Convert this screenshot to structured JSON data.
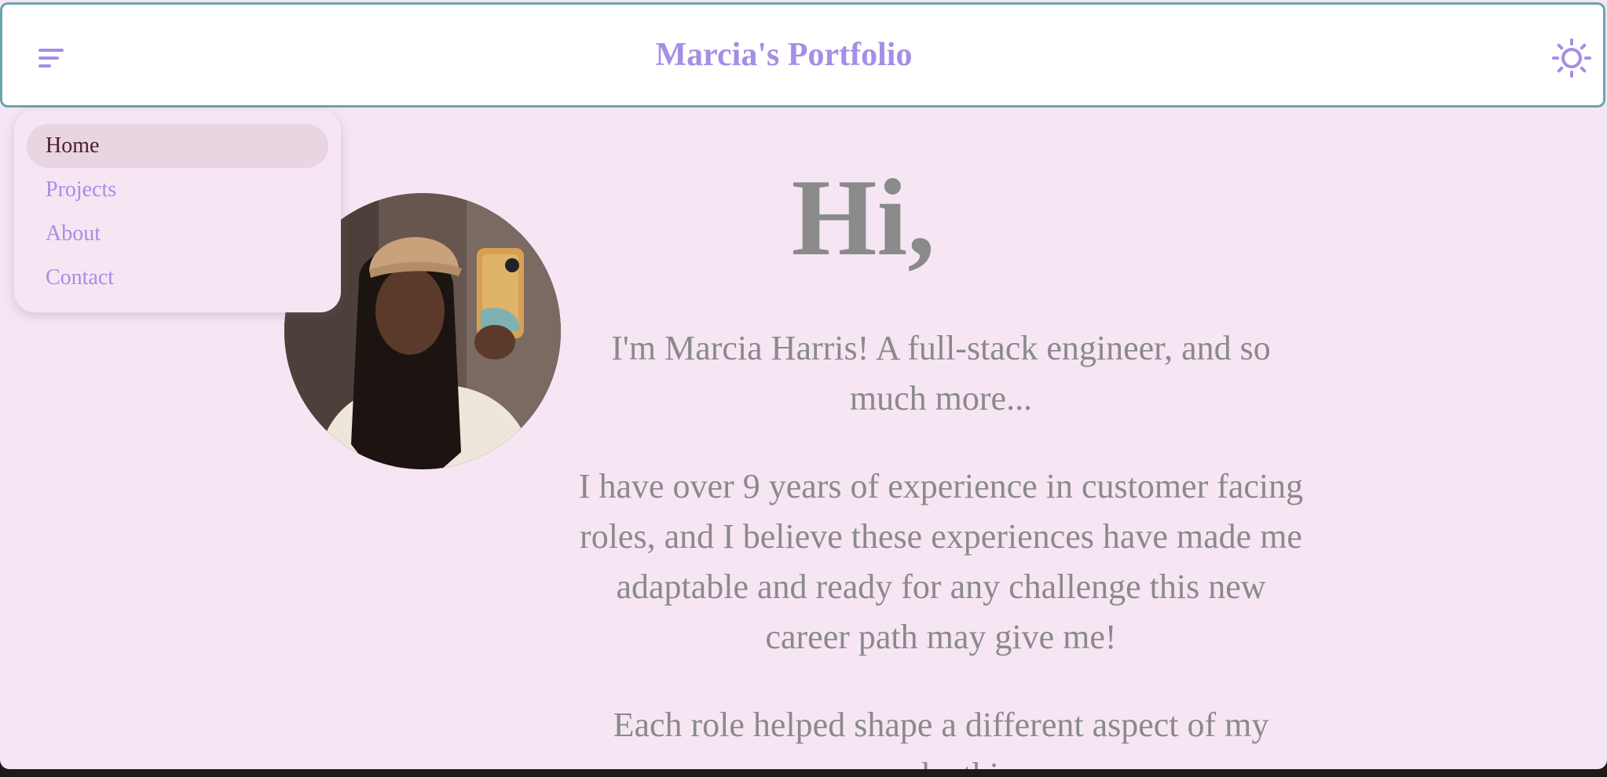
{
  "header": {
    "title": "Marcia's Portfolio",
    "menu_icon": "menu-icon",
    "theme_icon": "sun-icon"
  },
  "nav": {
    "items": [
      {
        "label": "Home",
        "active": true
      },
      {
        "label": "Projects",
        "active": false
      },
      {
        "label": "About",
        "active": false
      },
      {
        "label": "Contact",
        "active": false
      }
    ]
  },
  "hero": {
    "greeting": "Hi,",
    "intro": "I'm Marcia Harris! A full-stack engineer, and so much more...",
    "experience": "I have over 9 years of experience in customer facing roles, and I believe these experiences have made me adaptable and ready for any challenge this new career path may give me!",
    "ethic": "Each role helped shape a different aspect of my work ethic"
  },
  "colors": {
    "accent": "#a58ee6",
    "page_background": "#f6e6f3",
    "header_border": "#6aa6a8",
    "body_text": "#8a8a8a",
    "active_nav_text": "#4a1f2c"
  }
}
